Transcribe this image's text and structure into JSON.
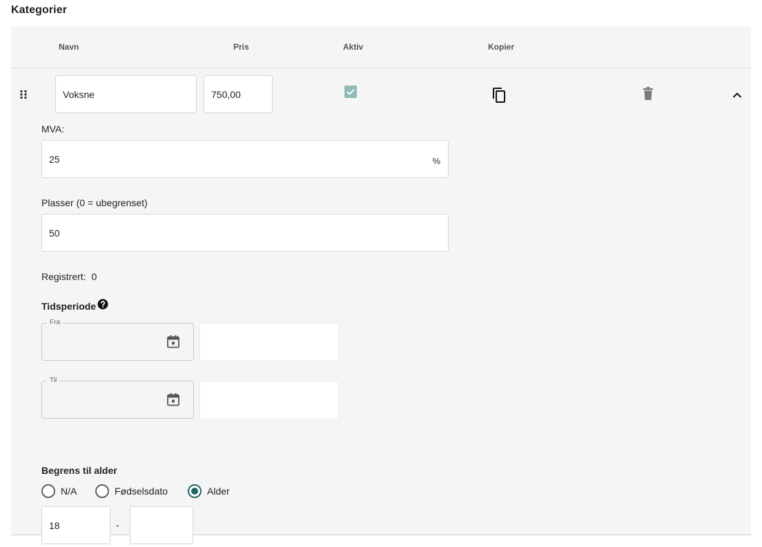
{
  "page": {
    "title": "Kategorier"
  },
  "table": {
    "columns": {
      "name": "Navn",
      "price": "Pris",
      "active": "Aktiv",
      "copy": "Kopier"
    }
  },
  "row": {
    "name_value": "Voksne",
    "price_value": "750,00",
    "active_checked": true,
    "vat": {
      "label": "MVA:",
      "value": "25",
      "suffix": "%"
    },
    "places": {
      "label": "Plasser (0 = ubegrenset)",
      "value": "50"
    },
    "registered": {
      "label": "Registrert:",
      "value": "0"
    },
    "time_period": {
      "label": "Tidsperiode",
      "from_label": "Fra",
      "to_label": "Til"
    },
    "age_limit": {
      "label": "Begrens til alder",
      "options": [
        "N/A",
        "Fødselsdato",
        "Alder"
      ],
      "selected": "Alder",
      "min_value": "18",
      "separator": "-",
      "max_value": ""
    }
  },
  "icons": {
    "drag": "drag-handle-icon",
    "copy": "copy-icon",
    "delete": "trash-icon",
    "collapse": "chevron-up-icon",
    "help": "help-circle-icon",
    "calendar": "calendar-icon",
    "check": "check-icon"
  },
  "colors": {
    "accent": "#1f6668",
    "checkbox": "#8fb8b8",
    "panel": "#f5f5f5"
  }
}
